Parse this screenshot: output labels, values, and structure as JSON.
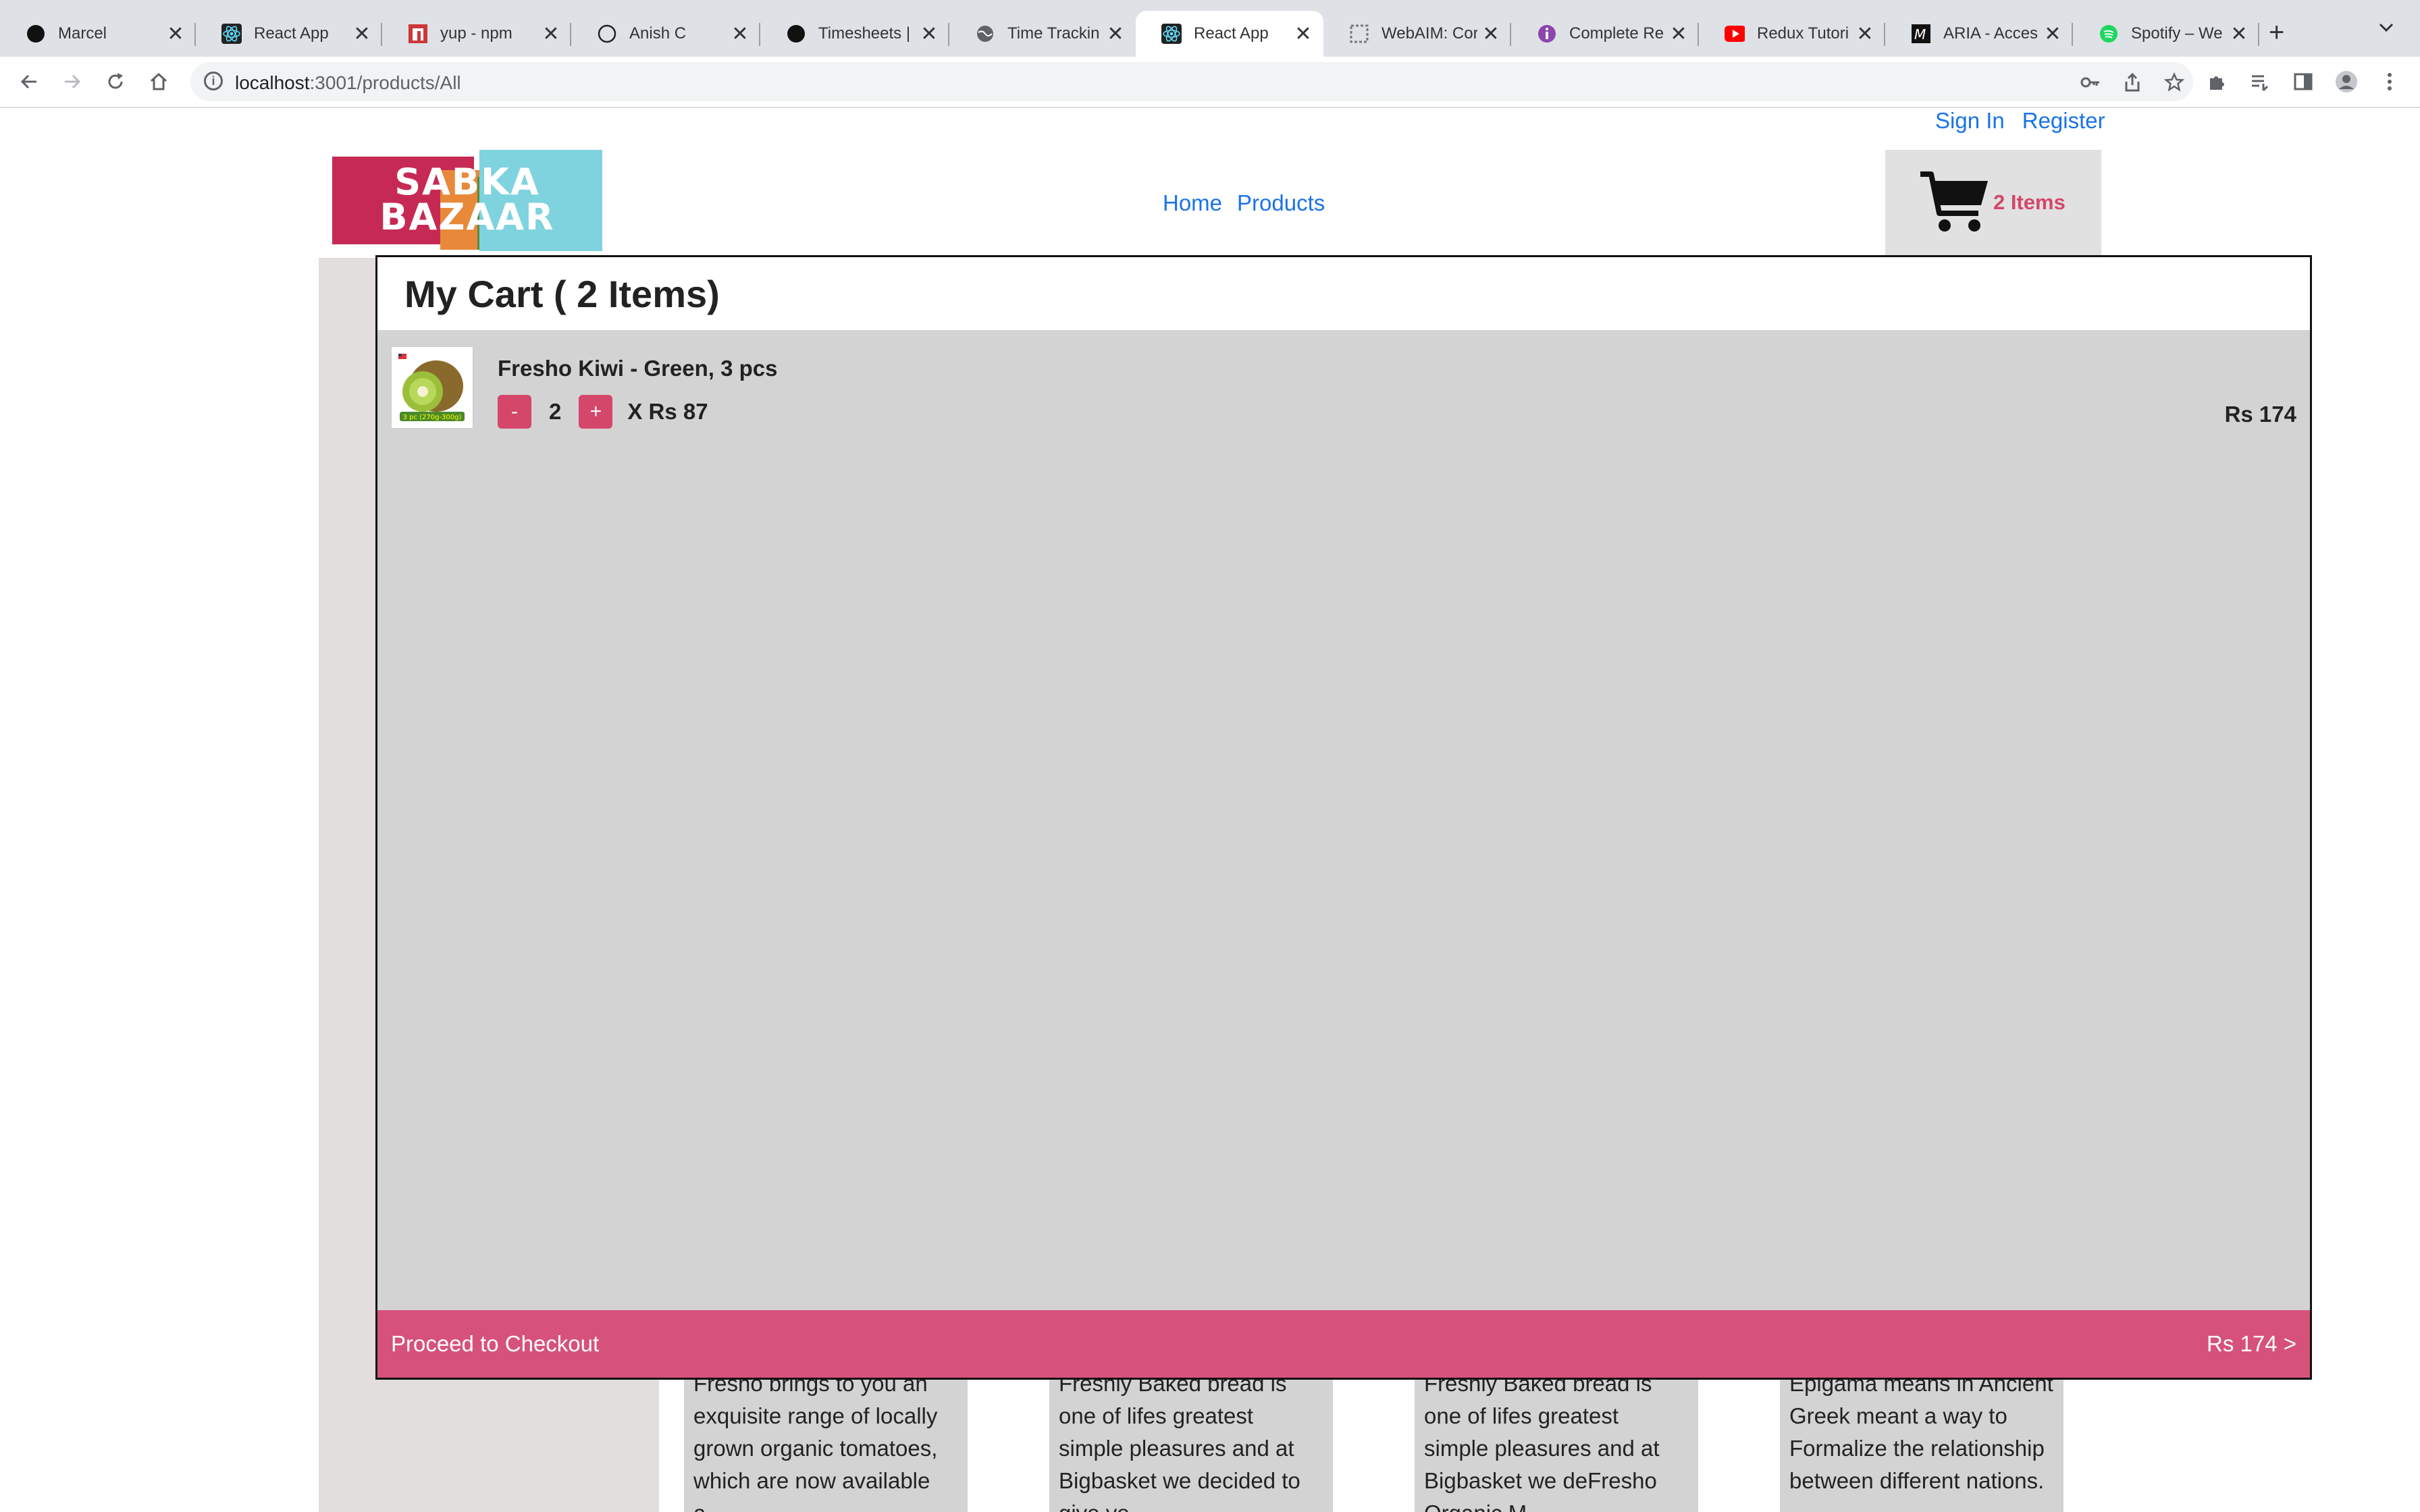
{
  "browser": {
    "tabs": [
      {
        "title": "Marcel",
        "icon": "circle-black-icon",
        "active": false
      },
      {
        "title": "React App",
        "icon": "react-icon",
        "active": false
      },
      {
        "title": "yup - npm",
        "icon": "npm-icon",
        "active": false
      },
      {
        "title": "Anish C",
        "icon": "github-icon",
        "active": false
      },
      {
        "title": "Timesheets |",
        "icon": "circle-black-icon",
        "active": false
      },
      {
        "title": "Time Trackin",
        "icon": "globe-icon",
        "active": false
      },
      {
        "title": "React App",
        "icon": "react-icon",
        "active": true
      },
      {
        "title": "WebAIM: Cor",
        "icon": "webaim-icon",
        "active": false
      },
      {
        "title": "Complete Re",
        "icon": "purple-info-icon",
        "active": false
      },
      {
        "title": "Redux Tutori",
        "icon": "youtube-icon",
        "active": false
      },
      {
        "title": "ARIA - Acces",
        "icon": "mdn-icon",
        "active": false
      },
      {
        "title": "Spotify – We",
        "icon": "spotify-icon",
        "active": false
      }
    ],
    "close_glyph": "✕",
    "new_tab_glyph": "+",
    "url_host": "localhost",
    "url_path": ":3001/products/All"
  },
  "header": {
    "sign_in": "Sign In",
    "register": "Register",
    "logo_line1": "SABKA",
    "logo_line2": "BAZAAR",
    "nav_home": "Home",
    "nav_products": "Products",
    "cart_count": "2 Items"
  },
  "cart": {
    "title": "My Cart ( 2 Items)",
    "items": [
      {
        "name": "Fresho Kiwi - Green, 3 pcs",
        "minus": "-",
        "qty": "2",
        "plus": "+",
        "unit_price": "X Rs 87",
        "total": "Rs 174",
        "thumb_label": "3 pc (270g-300g)"
      }
    ],
    "checkout_label": "Proceed to Checkout",
    "checkout_total": "Rs 174 >"
  },
  "background_products": [
    "Fresho brings to you an exquisite range of locally grown organic tomatoes, which are now available a...",
    "Freshly Baked bread is one of lifes greatest simple pleasures and at Bigbasket we decided to give yo...",
    "Freshly Baked bread is one of lifes greatest simple pleasures and at Bigbasket we deFresho Organic M...",
    "Epigama means in Ancient Greek meant a way to Formalize the relationship between different nations."
  ],
  "colors": {
    "accent": "#d6527a",
    "link": "#1a73e8",
    "modal_body": "#d3d3d3"
  }
}
